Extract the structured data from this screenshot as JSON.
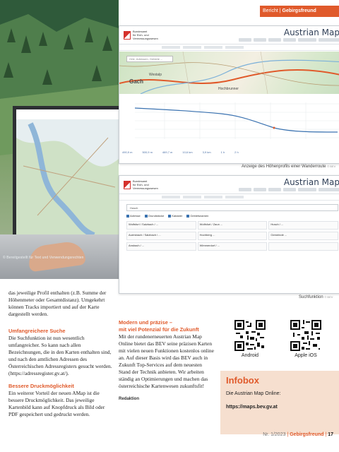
{
  "header": {
    "section": "Bericht",
    "magazine": "Gebirgsfreund"
  },
  "photo": {
    "caption": "© Bereitgestellt für Text und Verwendungsrechten"
  },
  "top_screenshot": {
    "app_title": "Austrian Map",
    "org_lines": [
      "Bundesamt",
      "für Eich- und",
      "Vermessungswesen"
    ],
    "search_placeholder": "Orte, Adressen, Gebiete ...",
    "places": [
      "Gach",
      "Hochbrunner",
      "Westalp"
    ],
    "caption": "Anzeige des Höhenprofils einer Wanderroute",
    "caption_credit": "© BEV",
    "profile_stats": [
      "490,9 m",
      "500,9 m",
      "469,7 m",
      "10,6 km",
      "3,9 km",
      "1 h",
      "2 h"
    ]
  },
  "bottom_screenshot": {
    "app_title": "Austrian Map",
    "org_lines": [
      "Bundesamt",
      "für Eich- und",
      "Vermessungswesen"
    ],
    "search_value": "Husch",
    "filters": [
      "Adresse",
      "Grundstücke",
      "Kataster",
      "Gebietsnamen"
    ],
    "results": [
      [
        "Wolfsfurt / Salzbach / ...",
        "Wolfsfurt / Zaun ...",
        "Husch / ..."
      ],
      [
        "Auersbach / Salzbach / ...",
        "Hochberg ...",
        "Gemeinde ..."
      ],
      [
        "Ansbach / ...",
        "Wimmerdorf / ...",
        ""
      ]
    ],
    "caption": "Suchfunktion",
    "caption_credit": "© BEV"
  },
  "col1": {
    "intro": "das jeweilige Profil enthalten (z.B. Summe der Höhenmeter oder Gesamtdistanz). Umgekehrt können Tracks importiert und auf der Karte dargestellt werden.",
    "h1": "Umfangreichere Suche",
    "p1": "Die Suchfunktion ist nun wesentlich umfangreicher. So kann nach allen Bezeichnungen, die in den Karten enthalten sind, und nach den amtlichen Adressen des Österreichischen Adressregisters gesucht werden. (https://adressregister.gv.at/).",
    "h2": "Bessere Druckmöglichkeit",
    "p2": "Ein weiterer Vorteil der neuen AMap ist die bessere Druckmöglichkeit. Das jeweilige Kartenbild kann auf Knopfdruck als Bild oder PDF gespeichert und gedruckt werden."
  },
  "col2": {
    "h1": "Modern und präzise –",
    "h2": "mit viel Potenzial für die Zukunft",
    "p1": "Mit der rundenerneuerten Austrian Map Online bietet das BEV seine präzisen Karten mit vielen neuen Funktionen kostenlos online an. Auf dieser Basis wird das BEV auch in Zukunft Top-Services auf dem neuesten Stand der Technik anbieten. Wir arbeiten ständig an Optimierungen und machen das österreichische Kartenwesen zukunftsfit!",
    "signature": "Redaktion"
  },
  "qr": {
    "android": "Android",
    "ios": "Apple iOS"
  },
  "infobox": {
    "title": "Infobox",
    "text": "Die Austrian Map Online:",
    "url": "https://maps.bev.gv.at"
  },
  "footer": {
    "issue": "Nr. 1/2023",
    "magazine": "Gebirgsfreund",
    "page": "17"
  },
  "colors": {
    "accent": "#e05a2b",
    "infobox_bg": "#f6dfcf"
  }
}
